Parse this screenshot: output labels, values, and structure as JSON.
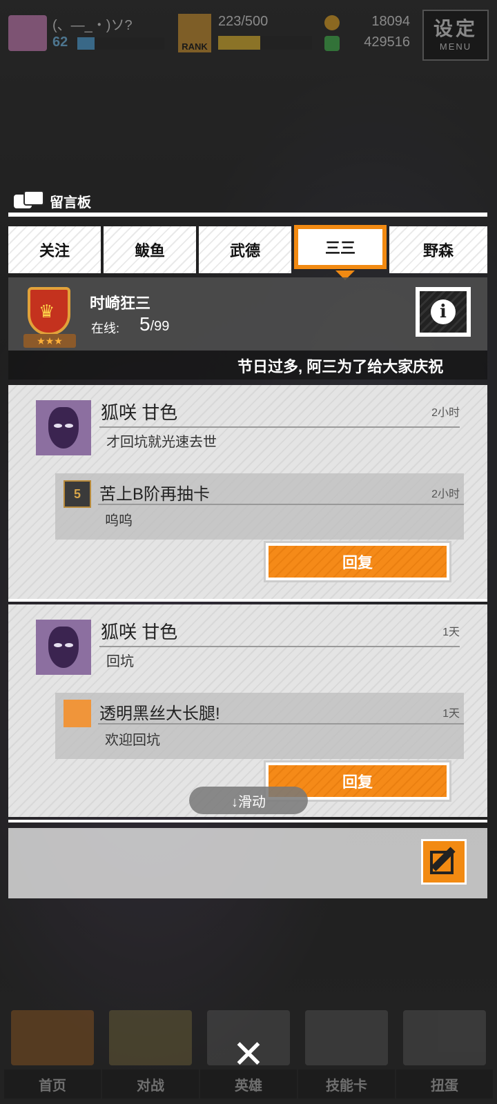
{
  "topbar": {
    "player_name": "(、—_・)ソ?",
    "level": "62",
    "level_progress": 0.2,
    "rank_label": "RANK",
    "stamina": "223/500",
    "stamina_progress": 0.45,
    "coins": "18094",
    "gems": "429516",
    "menu_big": "设定",
    "menu_small": "MENU"
  },
  "board": {
    "title": "留言板",
    "tabs": [
      "关注",
      "鲅鱼",
      "武德",
      "三三",
      "野森"
    ],
    "active_tab": 3
  },
  "guild": {
    "name": "时崎狂三",
    "online_label": "在线:",
    "online_count": "5",
    "online_max": "/99",
    "stars": "★★★",
    "ticker": "节日过多, 阿三为了给大家庆祝"
  },
  "posts": [
    {
      "author": "狐咲 甘色",
      "time": "2小时",
      "message": "才回坑就光速去世",
      "reply": {
        "author": "苦上B阶再抽卡",
        "time": "2小时",
        "message": "呜呜",
        "badge": "5"
      },
      "reply_button": "回复"
    },
    {
      "author": "狐咲 甘色",
      "time": "1天",
      "message": "回坑",
      "reply": {
        "author": "透明黑丝大长腿!",
        "time": "1天",
        "message": "欢迎回坑"
      },
      "reply_button": "回复"
    }
  ],
  "scroll_hint": "↓滑动",
  "bottom_nav": [
    "首页",
    "对战",
    "英雄",
    "技能卡",
    "扭蛋"
  ],
  "colors": {
    "accent": "#f28a12"
  }
}
